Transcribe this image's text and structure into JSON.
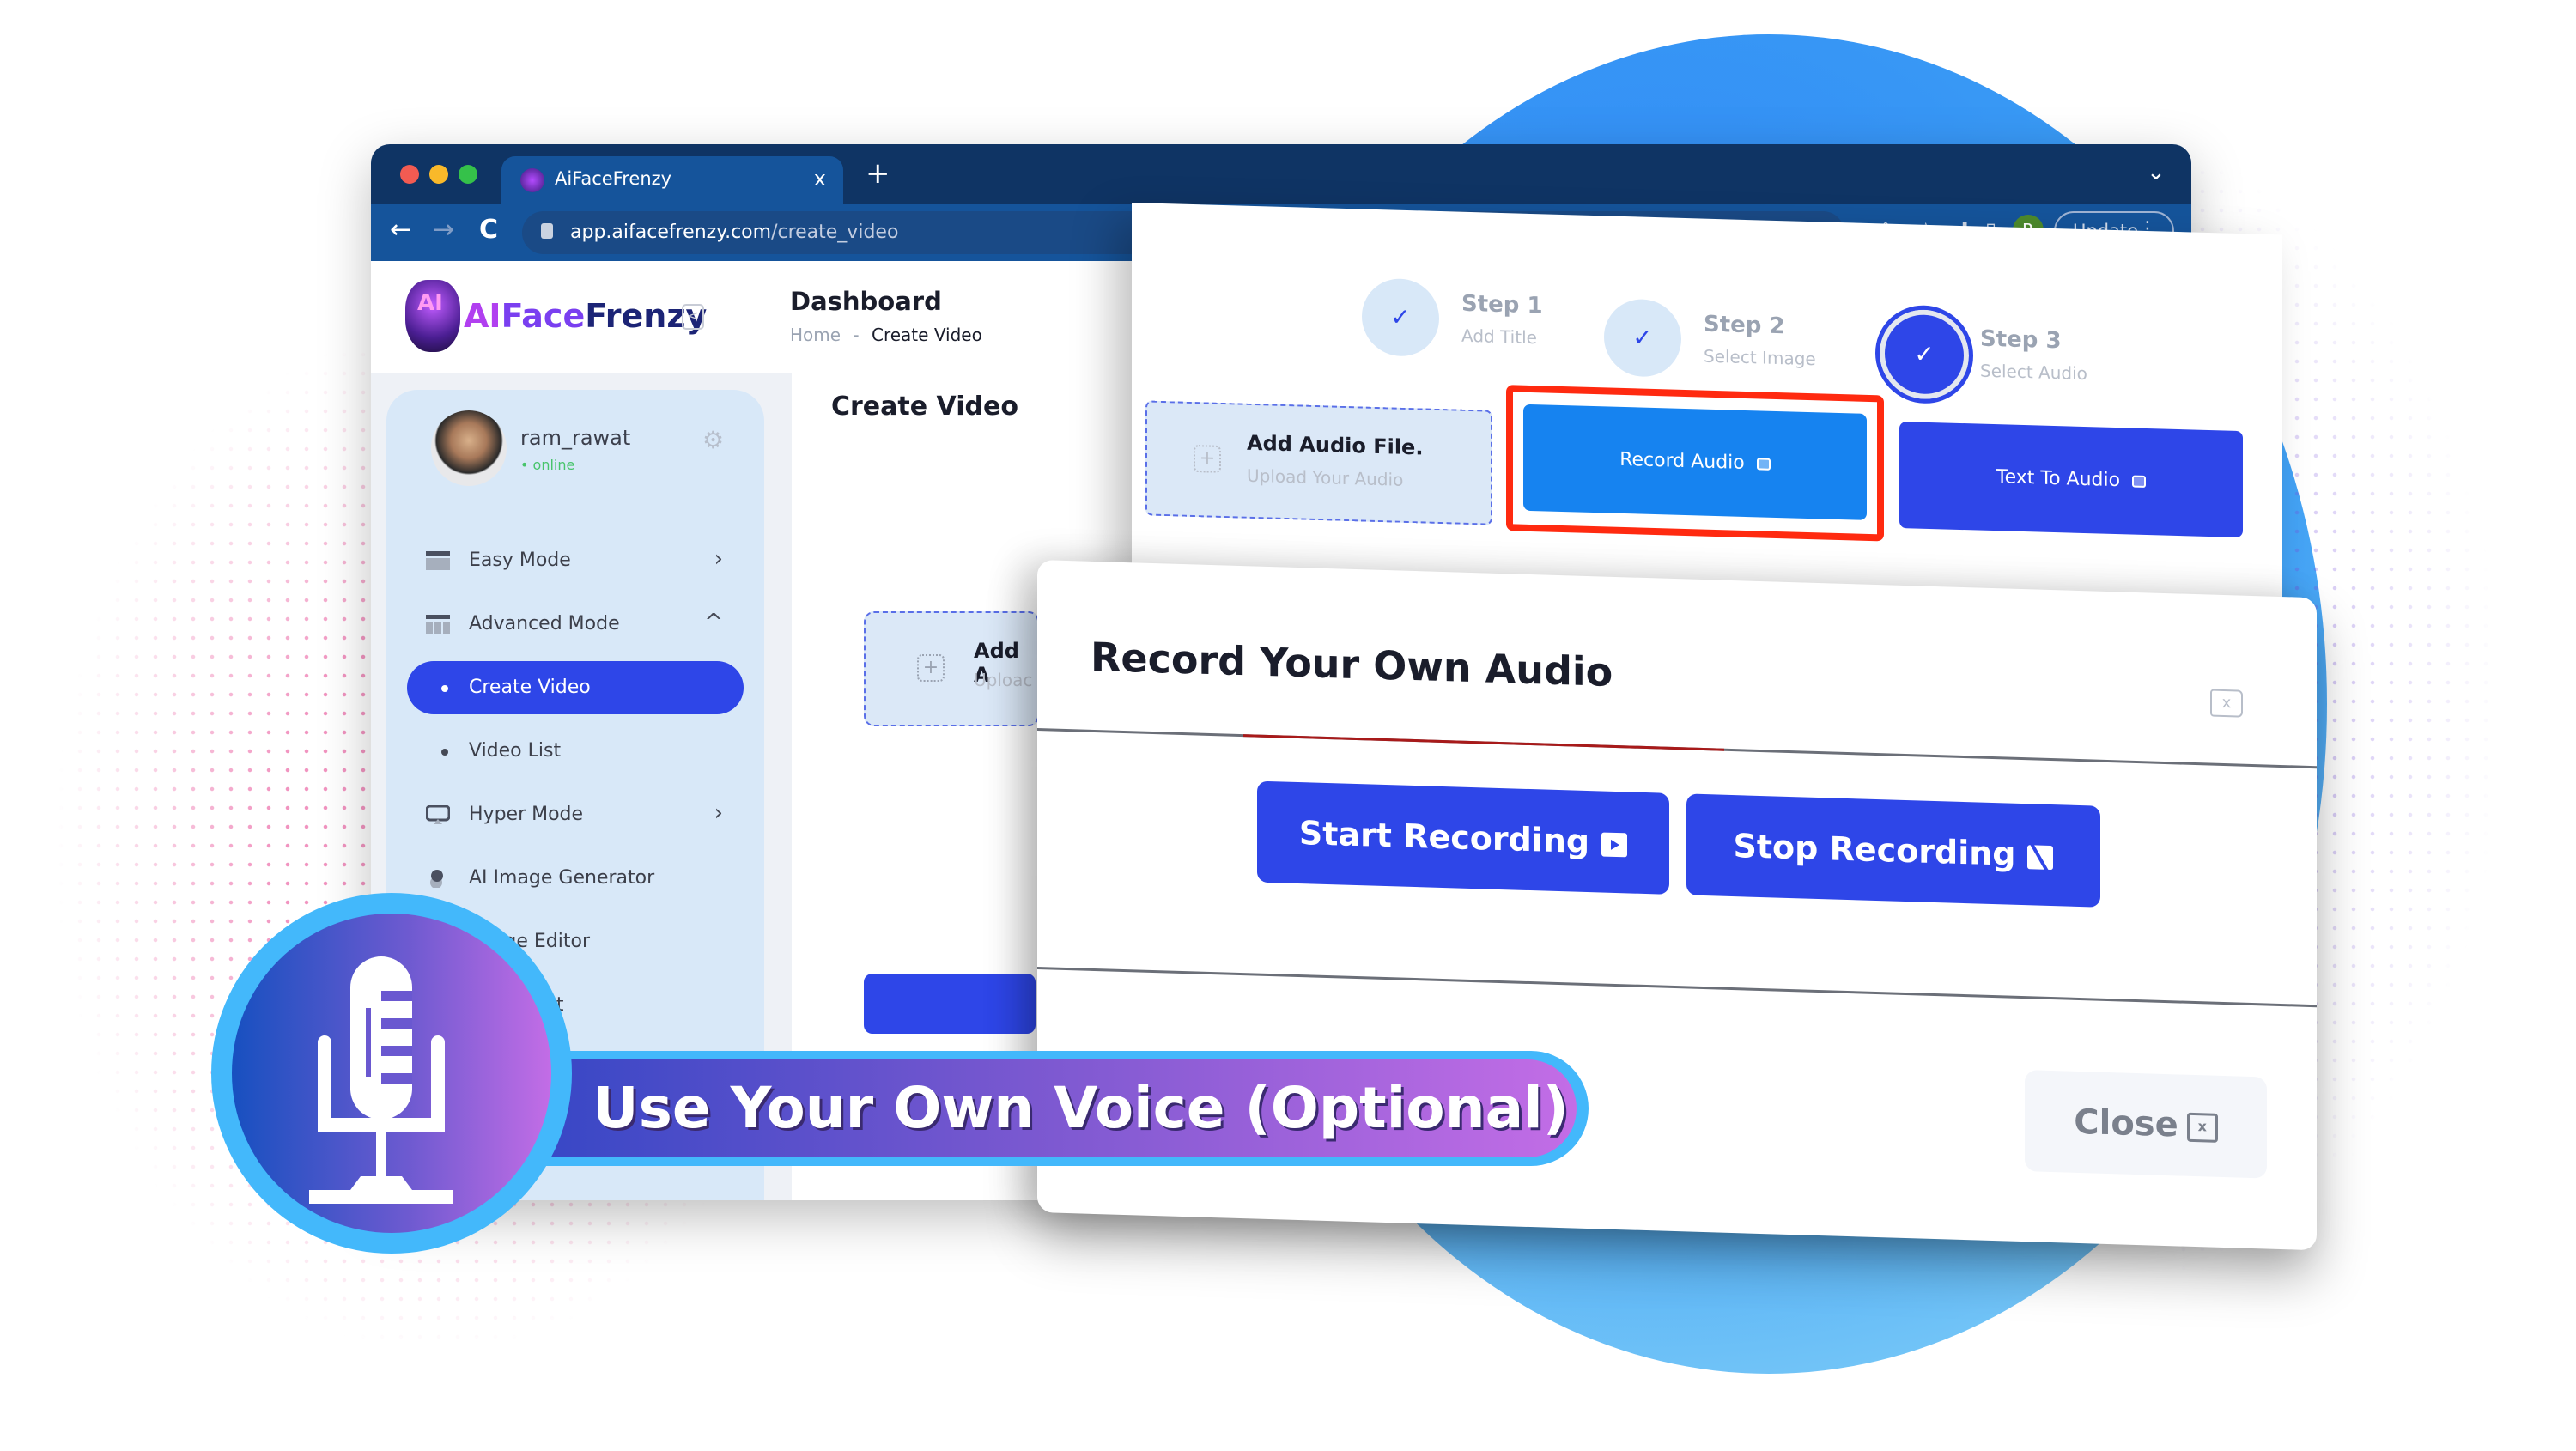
{
  "browser": {
    "tab_title": "AiFaceFrenzy",
    "tab_close": "x",
    "new_tab": "+",
    "url_host": "app.aifacefrenzy.com",
    "url_path": "/create_video",
    "profile_initial": "R",
    "update_label": "Update",
    "menu_glyph": "⋮",
    "tab_list_glyph": "⌄",
    "back_glyph": "←",
    "forward_glyph": "→",
    "reload_glyph": "C"
  },
  "app": {
    "logo_ai": "AI",
    "logo_face": "Face",
    "logo_frenzy": "Frenzy",
    "logo_badge": "AI",
    "collapse_glyph": "<",
    "header_title": "Dashboard",
    "breadcrumb": {
      "home": "Home",
      "sep": "-",
      "current": "Create Video"
    },
    "user": {
      "name": "ram_rawat",
      "status": "• online",
      "gear_glyph": "⚙"
    },
    "sidebar": {
      "items": [
        {
          "label": "Easy Mode",
          "chevron": "›",
          "icon": "window-icon"
        },
        {
          "label": "Advanced Mode",
          "chevron": "^",
          "icon": "grid-icon"
        },
        {
          "label": "Create Video",
          "active": true
        },
        {
          "label": "Video List"
        },
        {
          "label": "Hyper Mode",
          "chevron": "›",
          "icon": "screen-cast-icon"
        },
        {
          "label": "AI Image Generator",
          "icon": "user-circle-icon"
        },
        {
          "label": "Image Editor",
          "icon": "image-icon"
        },
        {
          "label": "Editor List",
          "icon": "list-icon"
        }
      ]
    },
    "main_title": "Create Video",
    "bg_drop": {
      "title": "Add A",
      "subtitle": "Uploac",
      "plus": "+"
    }
  },
  "stepper": {
    "steps": [
      {
        "title": "Step 1",
        "subtitle": "Add Title",
        "check": "✓"
      },
      {
        "title": "Step 2",
        "subtitle": "Select Image",
        "check": "✓"
      },
      {
        "title": "Step 3",
        "subtitle": "Select Audio",
        "check": "✓",
        "active": true
      }
    ],
    "add_audio": {
      "title": "Add Audio File.",
      "subtitle": "Upload Your Audio",
      "plus": "+"
    },
    "record_audio_label": "Record Audio",
    "text_to_audio_label": "Text To Audio"
  },
  "modal": {
    "title": "Record Your Own Audio",
    "close_icon_glyph": "x",
    "start_label": "Start Recording",
    "stop_label": "Stop Recording",
    "close_label": "Close",
    "close_glyph": "x"
  },
  "banner": {
    "text": "Use Your Own Voice (Optional)"
  },
  "colors": {
    "primary": "#2e46e8",
    "record_blue": "#1683f0",
    "highlight_red": "#ff2a10",
    "browser_dark": "#0f3464",
    "browser_mid": "#15549b",
    "sidebar_bg": "#d8e8f8",
    "banner_border": "#43b8fb"
  }
}
